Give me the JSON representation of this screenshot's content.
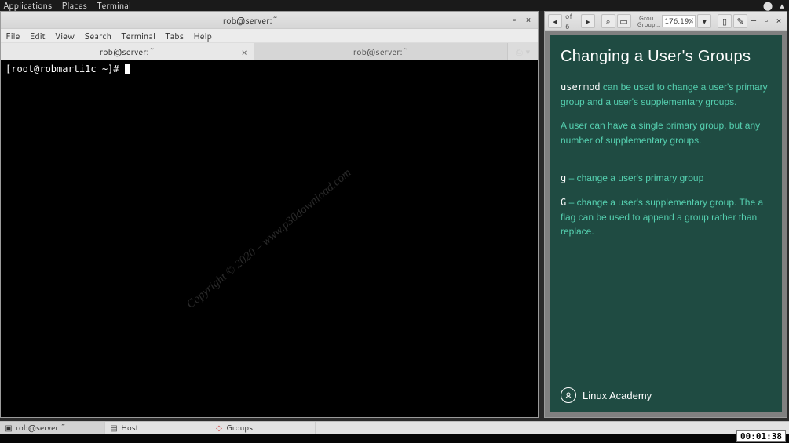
{
  "gnome_panel": {
    "apps": "Applications",
    "places": "Places",
    "terminal": "Terminal"
  },
  "terminal": {
    "title": "rob@server:~",
    "menu": [
      "File",
      "Edit",
      "View",
      "Search",
      "Terminal",
      "Tabs",
      "Help"
    ],
    "tabs": [
      "rob@server:~",
      "rob@server:~"
    ],
    "prompt": "[root@robmarti1c ~]# ",
    "watermark": "Copyright © 2020 – www.p30download.com"
  },
  "pdf_viewer": {
    "page_indicator": "of 6",
    "group_label": "Grou…",
    "group_sub": "Group…",
    "zoom": "176.19%",
    "slide": {
      "title": "Changing a User's Groups",
      "p1_code": "usermod",
      "p1_rest": " can be used to change a user's primary group and a user's supplementary groups.",
      "p2": "A user can have a single primary group, but any number of supplementary groups.",
      "p3_flag": "g",
      "p3_rest": " – change a user's primary group",
      "p4_flag": "G",
      "p4_rest": " – change a user's supplementary group. The a flag can be used to append a group rather than replace.",
      "brand": "Linux Academy"
    }
  },
  "taskbar": {
    "items": [
      {
        "icon_name": "terminal-icon",
        "label": "rob@server:~"
      },
      {
        "icon_name": "host-icon",
        "label": "Host"
      },
      {
        "icon_name": "pdf-icon",
        "label": "Groups"
      }
    ]
  },
  "timer": "00:01:38"
}
